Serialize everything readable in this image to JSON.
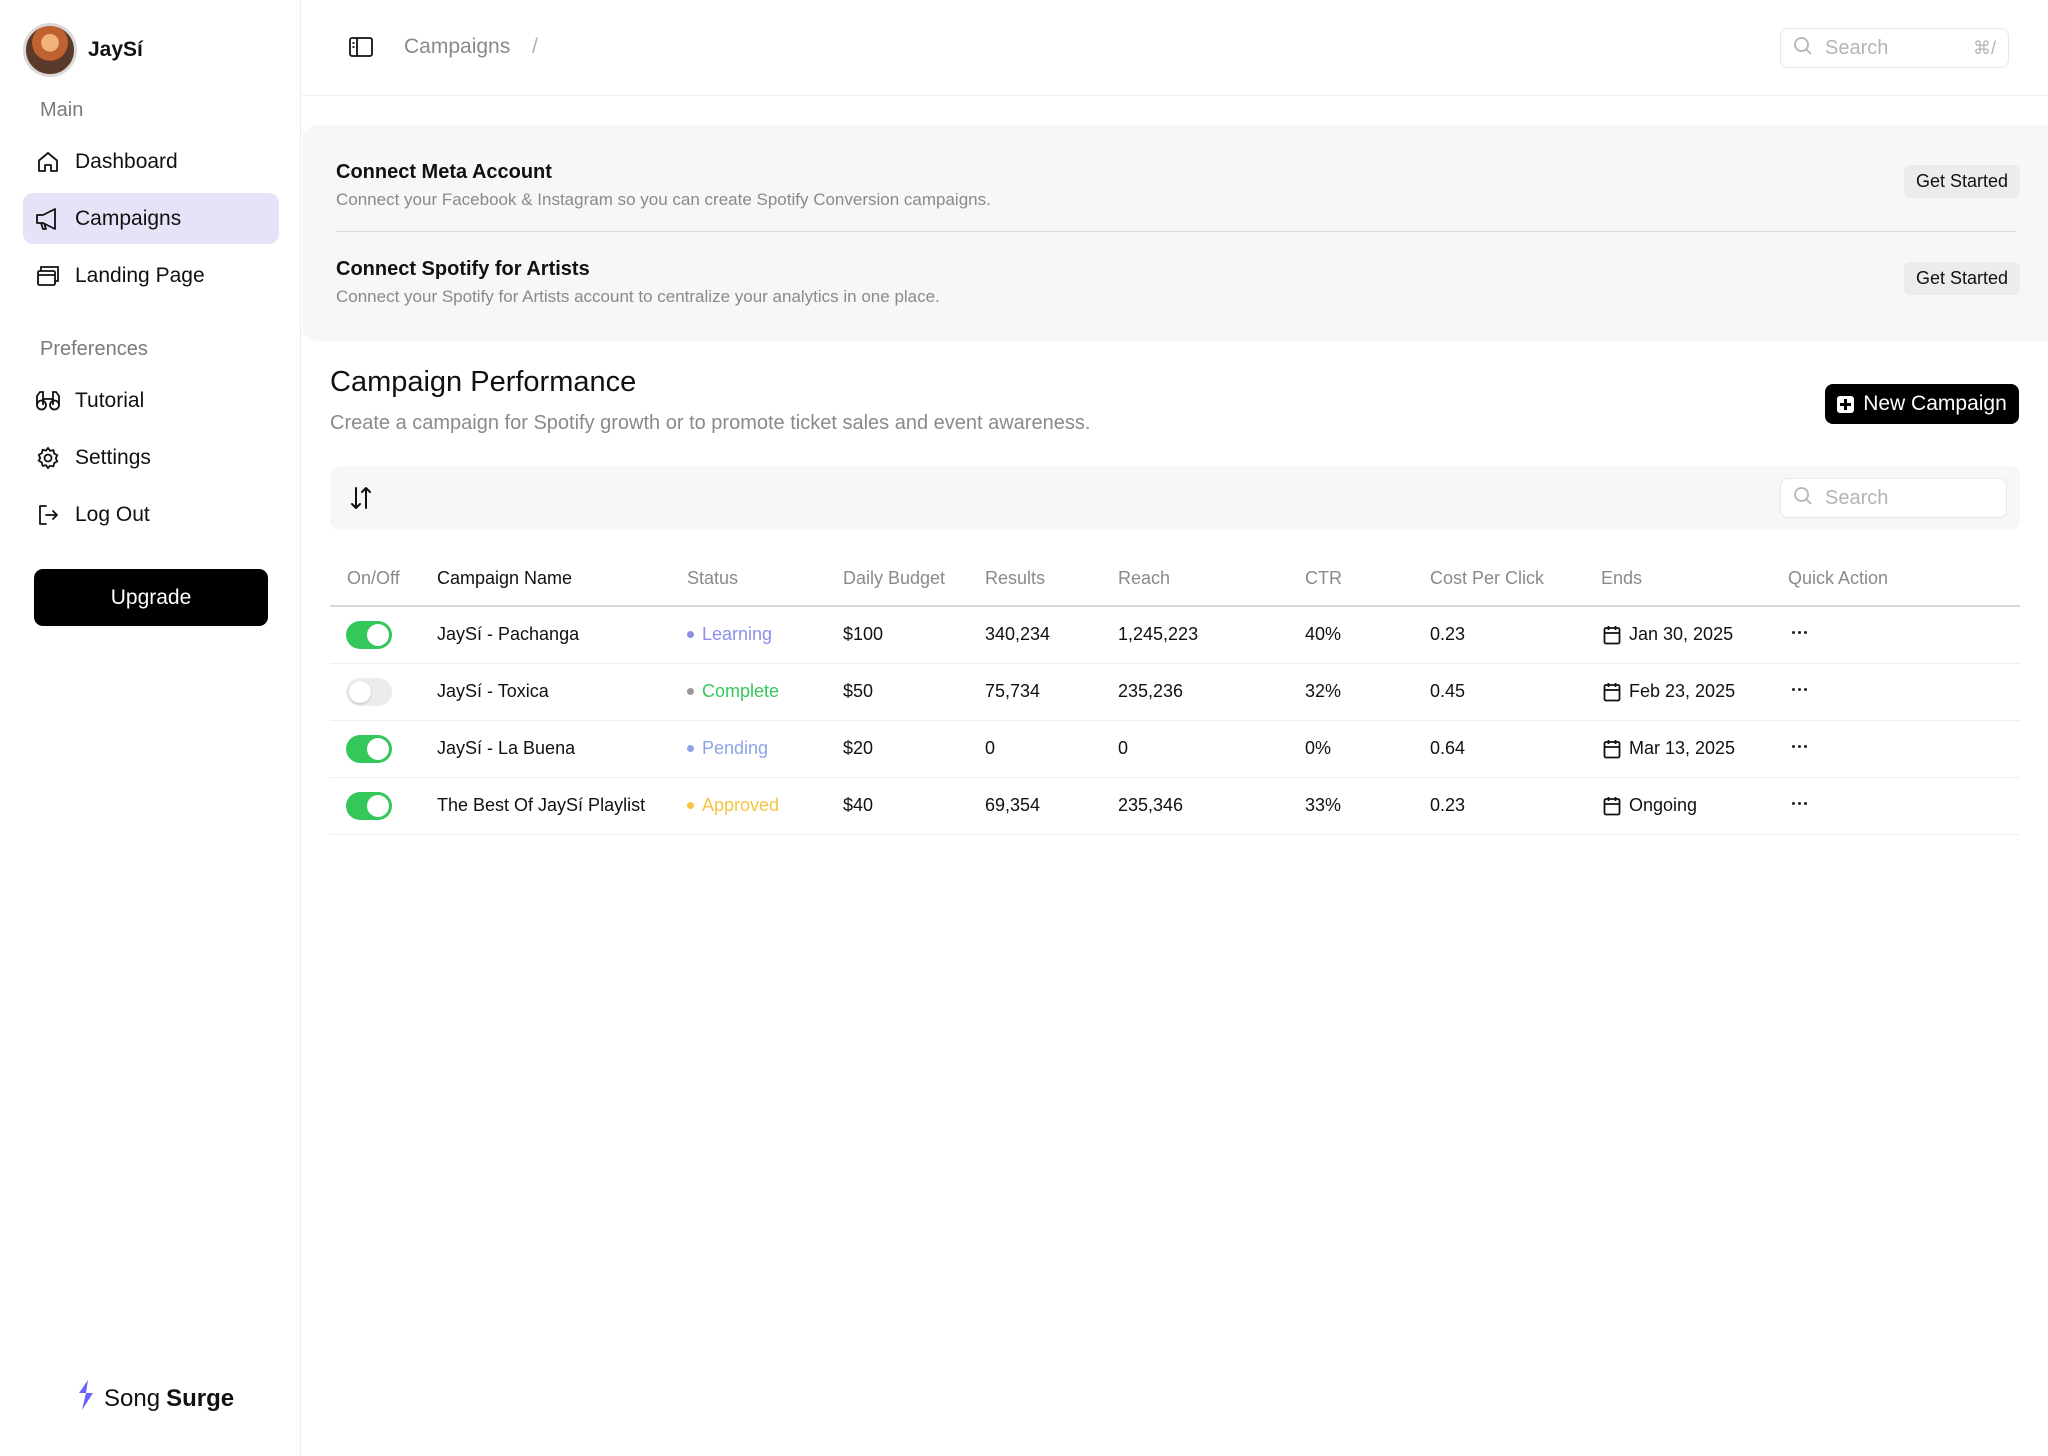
{
  "profile": {
    "name": "JaySí"
  },
  "sidebar": {
    "main_label": "Main",
    "main_items": [
      {
        "label": "Dashboard",
        "icon": "home-icon"
      },
      {
        "label": "Campaigns",
        "icon": "megaphone-icon",
        "active": true
      },
      {
        "label": "Landing Page",
        "icon": "windows-icon"
      }
    ],
    "preferences_label": "Preferences",
    "pref_items": [
      {
        "label": "Tutorial",
        "icon": "binoculars-icon"
      },
      {
        "label": "Settings",
        "icon": "gear-icon"
      },
      {
        "label": "Log Out",
        "icon": "logout-icon"
      }
    ],
    "upgrade_label": "Upgrade",
    "brand_first": "Song",
    "brand_second": "Surge",
    "brand_color": "#6c63ff"
  },
  "topbar": {
    "breadcrumb": "Campaigns",
    "breadcrumb_sep": "/",
    "search_placeholder": "Search",
    "shortcut": "⌘/"
  },
  "connect": [
    {
      "title": "Connect Meta Account",
      "desc": "Connect your Facebook & Instagram so you can create Spotify Conversion campaigns.",
      "button": "Get Started"
    },
    {
      "title": "Connect Spotify for Artists",
      "desc": "Connect your Spotify for Artists account to centralize your analytics in one place.",
      "button": "Get Started"
    }
  ],
  "performance": {
    "title": "Campaign Performance",
    "subtitle": "Create a campaign for Spotify growth or to promote ticket sales and event awareness.",
    "new_button": "New Campaign",
    "search_placeholder": "Search"
  },
  "table": {
    "headers": [
      "On/Off",
      "Campaign Name",
      "Status",
      "Daily Budget",
      "Results",
      "Reach",
      "CTR",
      "Cost Per Click",
      "Ends",
      "Quick Action"
    ],
    "rows": [
      {
        "on": true,
        "name": "JaySí - Pachanga",
        "status": "Learning",
        "status_color": "#8b8fe8",
        "budget": "$100",
        "results": "340,234",
        "reach": "1,245,223",
        "ctr": "40%",
        "cpc": "0.23",
        "ends": "Jan 30, 2025"
      },
      {
        "on": false,
        "name": "JaySí - Toxica",
        "status": "Complete",
        "status_color": "#34c759",
        "dot_color": "#9a9a9a",
        "budget": "$50",
        "results": "75,734",
        "reach": "235,236",
        "ctr": "32%",
        "cpc": "0.45",
        "ends": "Feb 23, 2025"
      },
      {
        "on": true,
        "name": "JaySí - La Buena",
        "status": "Pending",
        "status_color": "#8fa4e8",
        "budget": "$20",
        "results": "0",
        "reach": "0",
        "ctr": "0%",
        "cpc": "0.64",
        "ends": "Mar 13, 2025"
      },
      {
        "on": true,
        "name": "The Best Of JaySí Playlist",
        "status": "Approved",
        "status_color": "#f5c542",
        "budget": "$40",
        "results": "69,354",
        "reach": "235,346",
        "ctr": "33%",
        "cpc": "0.23",
        "ends": "Ongoing"
      }
    ]
  }
}
